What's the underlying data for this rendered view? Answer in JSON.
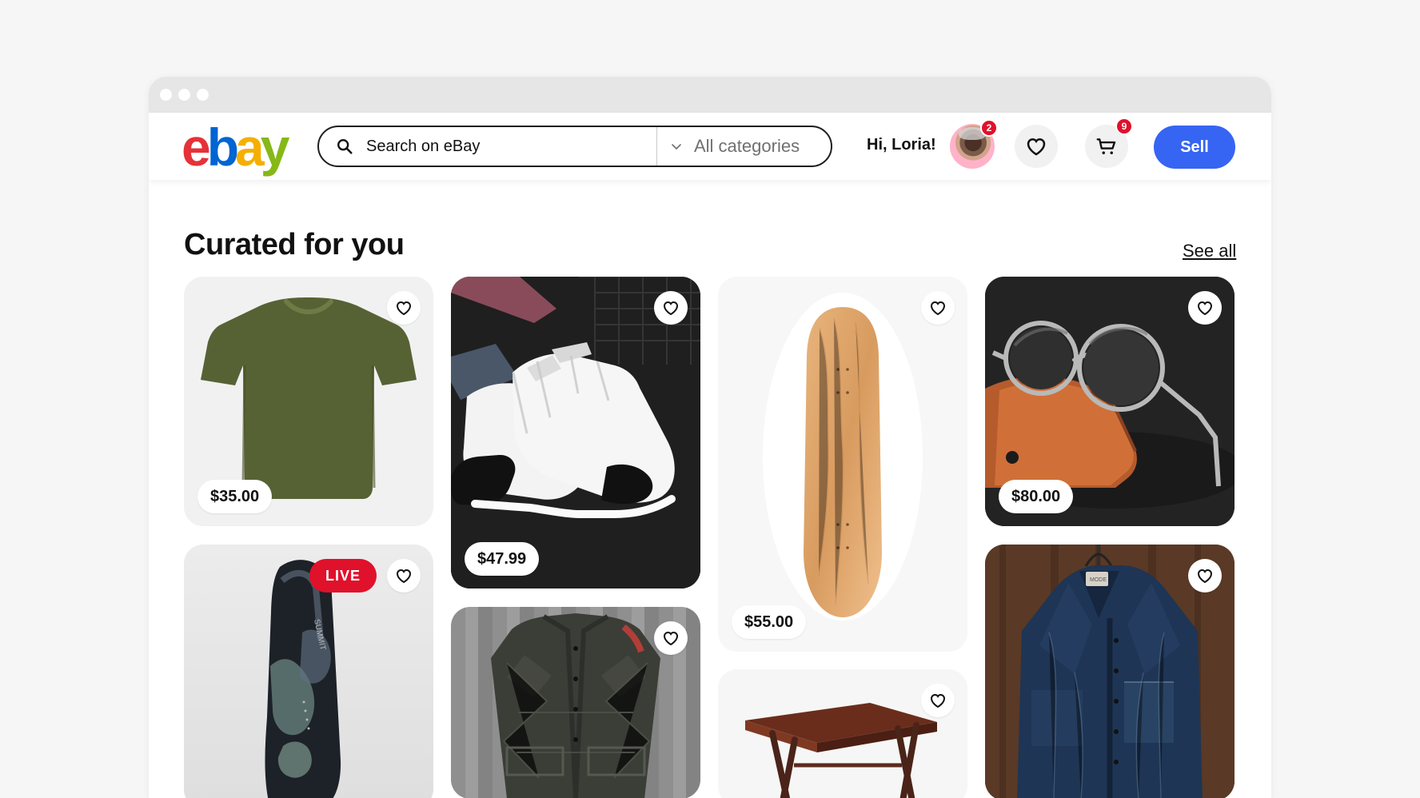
{
  "browser": {
    "controls": [
      "window-control",
      "window-control",
      "window-control"
    ]
  },
  "header": {
    "logo_letters": [
      "e",
      "b",
      "a",
      "y"
    ],
    "logo_colors": {
      "e": "#e53238",
      "b": "#0064d2",
      "a": "#f5af02",
      "y": "#86b817"
    },
    "search": {
      "placeholder": "Search on eBay",
      "category": "All categories"
    },
    "greeting": "Hi, Loria!",
    "avatar_badge": "2",
    "cart_badge": "9",
    "sell_label": "Sell",
    "accent": "#3665f3"
  },
  "main": {
    "title": "Curated for you",
    "see_all_label": "See all",
    "products": [
      {
        "name": "t-shirt-card",
        "price": "$35.00",
        "icon": "heart-icon"
      },
      {
        "name": "sneaker-card",
        "price": "$47.99",
        "icon": "heart-icon"
      },
      {
        "name": "skateboard-card",
        "price": "$55.00",
        "icon": "heart-icon"
      },
      {
        "name": "sunglasses-card",
        "price": "$80.00",
        "icon": "heart-icon"
      },
      {
        "name": "snowboard-card",
        "badge": "LIVE",
        "icon": "heart-icon"
      },
      {
        "name": "vest-card",
        "icon": "heart-icon"
      },
      {
        "name": "table-card",
        "icon": "heart-icon"
      },
      {
        "name": "jacket-card",
        "icon": "heart-icon"
      }
    ]
  }
}
